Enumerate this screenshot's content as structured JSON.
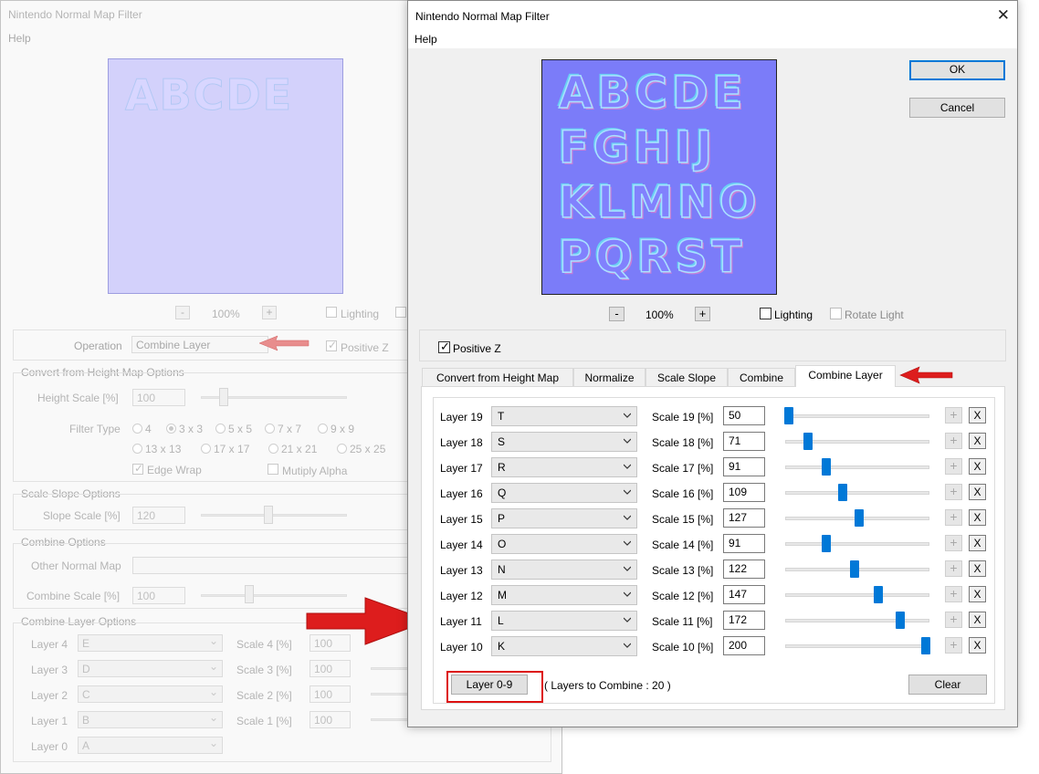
{
  "bg_dialog": {
    "title": "Nintendo Normal Map Filter",
    "menu_help": "Help",
    "preview_letters": "ABCDE",
    "zoom_minus": "-",
    "zoom_level": "100%",
    "zoom_plus": "+",
    "lighting_label": "Lighting",
    "operation_label": "Operation",
    "operation_value": "Combine Layer",
    "positive_z_label": "Positive Z",
    "height_map_options_label": "Convert from Height Map Options",
    "height_scale_label": "Height Scale [%]",
    "height_scale_value": "100",
    "filter_type_label": "Filter Type",
    "filter_types": [
      "4",
      "3 x 3",
      "5 x 5",
      "7 x 7",
      "9 x 9",
      "13 x 13",
      "17 x 17",
      "21 x 21",
      "25 x 25"
    ],
    "edge_wrap_label": "Edge Wrap",
    "multiply_alpha_label": "Mutiply Alpha",
    "scale_slope_options_label": "Scale Slope Options",
    "slope_scale_label": "Slope Scale [%]",
    "slope_scale_value": "120",
    "combine_options_label": "Combine Options",
    "other_normal_map_label": "Other Normal Map",
    "combine_scale_label": "Combine Scale [%]",
    "combine_scale_value": "100",
    "combine_layer_options_label": "Combine Layer Options",
    "layers": [
      {
        "label": "Layer 4",
        "value": "E",
        "scale_label": "Scale 4 [%]",
        "scale": "100"
      },
      {
        "label": "Layer 3",
        "value": "D",
        "scale_label": "Scale 3 [%]",
        "scale": "100"
      },
      {
        "label": "Layer 2",
        "value": "C",
        "scale_label": "Scale 2 [%]",
        "scale": "100"
      },
      {
        "label": "Layer 1",
        "value": "B",
        "scale_label": "Scale 1 [%]",
        "scale": "100"
      },
      {
        "label": "Layer 0",
        "value": "A"
      }
    ]
  },
  "dialog": {
    "title": "Nintendo Normal Map Filter",
    "close_glyph": "✕",
    "menu_help": "Help",
    "preview_rows": [
      "ABCDE",
      "FGHIJ",
      "KLMNO",
      "PQRST"
    ],
    "ok_label": "OK",
    "cancel_label": "Cancel",
    "zoom_minus": "-",
    "zoom_level": "100%",
    "zoom_plus": "+",
    "lighting_label": "Lighting",
    "rotate_light_label": "Rotate Light",
    "positive_z_label": "Positive Z",
    "tabs": [
      "Convert from Height Map",
      "Normalize",
      "Scale Slope",
      "Combine",
      "Combine Layer"
    ],
    "active_tab": "Combine Layer",
    "layers": [
      {
        "label": "Layer 19",
        "value": "T",
        "scale_label": "Scale 19 [%]",
        "scale": "50",
        "level": 0.0
      },
      {
        "label": "Layer 18",
        "value": "S",
        "scale_label": "Scale 18 [%]",
        "scale": "71",
        "level": 0.14
      },
      {
        "label": "Layer 17",
        "value": "R",
        "scale_label": "Scale 17 [%]",
        "scale": "91",
        "level": 0.27
      },
      {
        "label": "Layer 16",
        "value": "Q",
        "scale_label": "Scale 16 [%]",
        "scale": "109",
        "level": 0.39
      },
      {
        "label": "Layer 15",
        "value": "P",
        "scale_label": "Scale 15 [%]",
        "scale": "127",
        "level": 0.51
      },
      {
        "label": "Layer 14",
        "value": "O",
        "scale_label": "Scale 14 [%]",
        "scale": "91",
        "level": 0.27
      },
      {
        "label": "Layer 13",
        "value": "N",
        "scale_label": "Scale 13 [%]",
        "scale": "122",
        "level": 0.48
      },
      {
        "label": "Layer 12",
        "value": "M",
        "scale_label": "Scale 12 [%]",
        "scale": "147",
        "level": 0.65
      },
      {
        "label": "Layer 11",
        "value": "L",
        "scale_label": "Scale 11 [%]",
        "scale": "172",
        "level": 0.81
      },
      {
        "label": "Layer 10",
        "value": "K",
        "scale_label": "Scale 10 [%]",
        "scale": "200",
        "level": 1.0
      }
    ],
    "plus_glyph": "+",
    "x_glyph": "X",
    "layer_range_button": "Layer 0-9",
    "layers_to_combine": "( Layers to Combine : 20 )",
    "clear_label": "Clear"
  },
  "colors": {
    "accent": "#0078d7",
    "annotation_red": "#dd1111",
    "preview_bg": "#7b7cf9"
  }
}
